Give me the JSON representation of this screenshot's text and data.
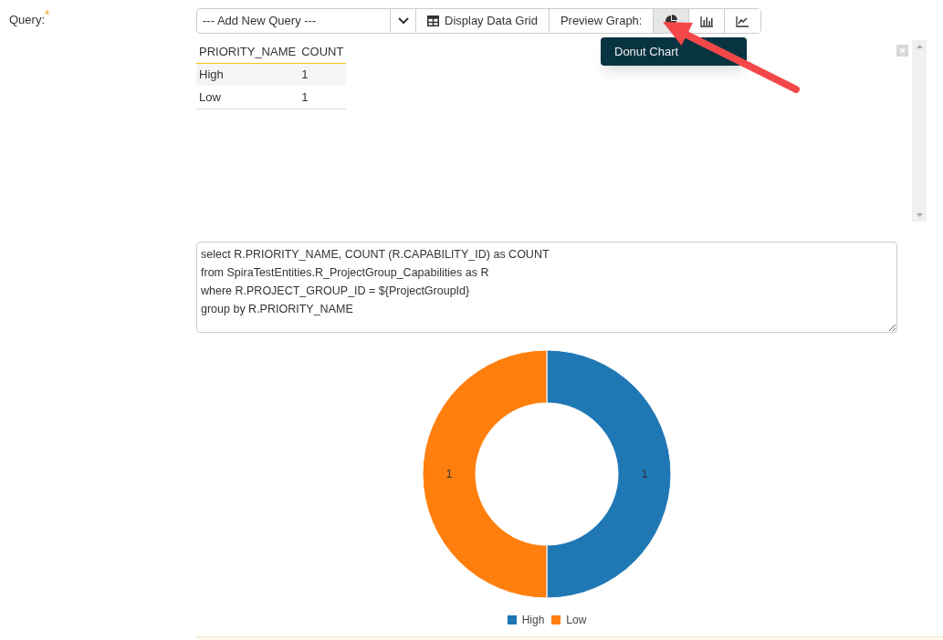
{
  "field": {
    "label": "Query:",
    "required_mark": "*"
  },
  "toolbar": {
    "query_select": {
      "value": "--- Add New Query ---"
    },
    "grid_button": {
      "label": "Display Data Grid"
    },
    "preview_label": "Preview Graph:",
    "graph_buttons": [
      {
        "kind": "pie",
        "selected": true
      },
      {
        "kind": "bar",
        "selected": false
      },
      {
        "kind": "line",
        "selected": false
      }
    ]
  },
  "tooltip": {
    "text": "Donut Chart"
  },
  "data_grid": {
    "columns": [
      "PRIORITY_NAME",
      "COUNT"
    ],
    "rows": [
      [
        "High",
        "1"
      ],
      [
        "Low",
        "1"
      ]
    ]
  },
  "sql": "select R.PRIORITY_NAME, COUNT (R.CAPABILITY_ID) as COUNT\nfrom SpiraTestEntities.R_ProjectGroup_Capabilities as R\nwhere R.PROJECT_GROUP_ID = ${ProjectGroupId}\ngroup by R.PRIORITY_NAME",
  "chart_data": {
    "type": "donut",
    "categories": [
      "High",
      "Low"
    ],
    "values": [
      1,
      1
    ],
    "data_labels": true,
    "legend": "bottom",
    "colors": [
      "#1f77b4",
      "#ff7f0e"
    ]
  }
}
